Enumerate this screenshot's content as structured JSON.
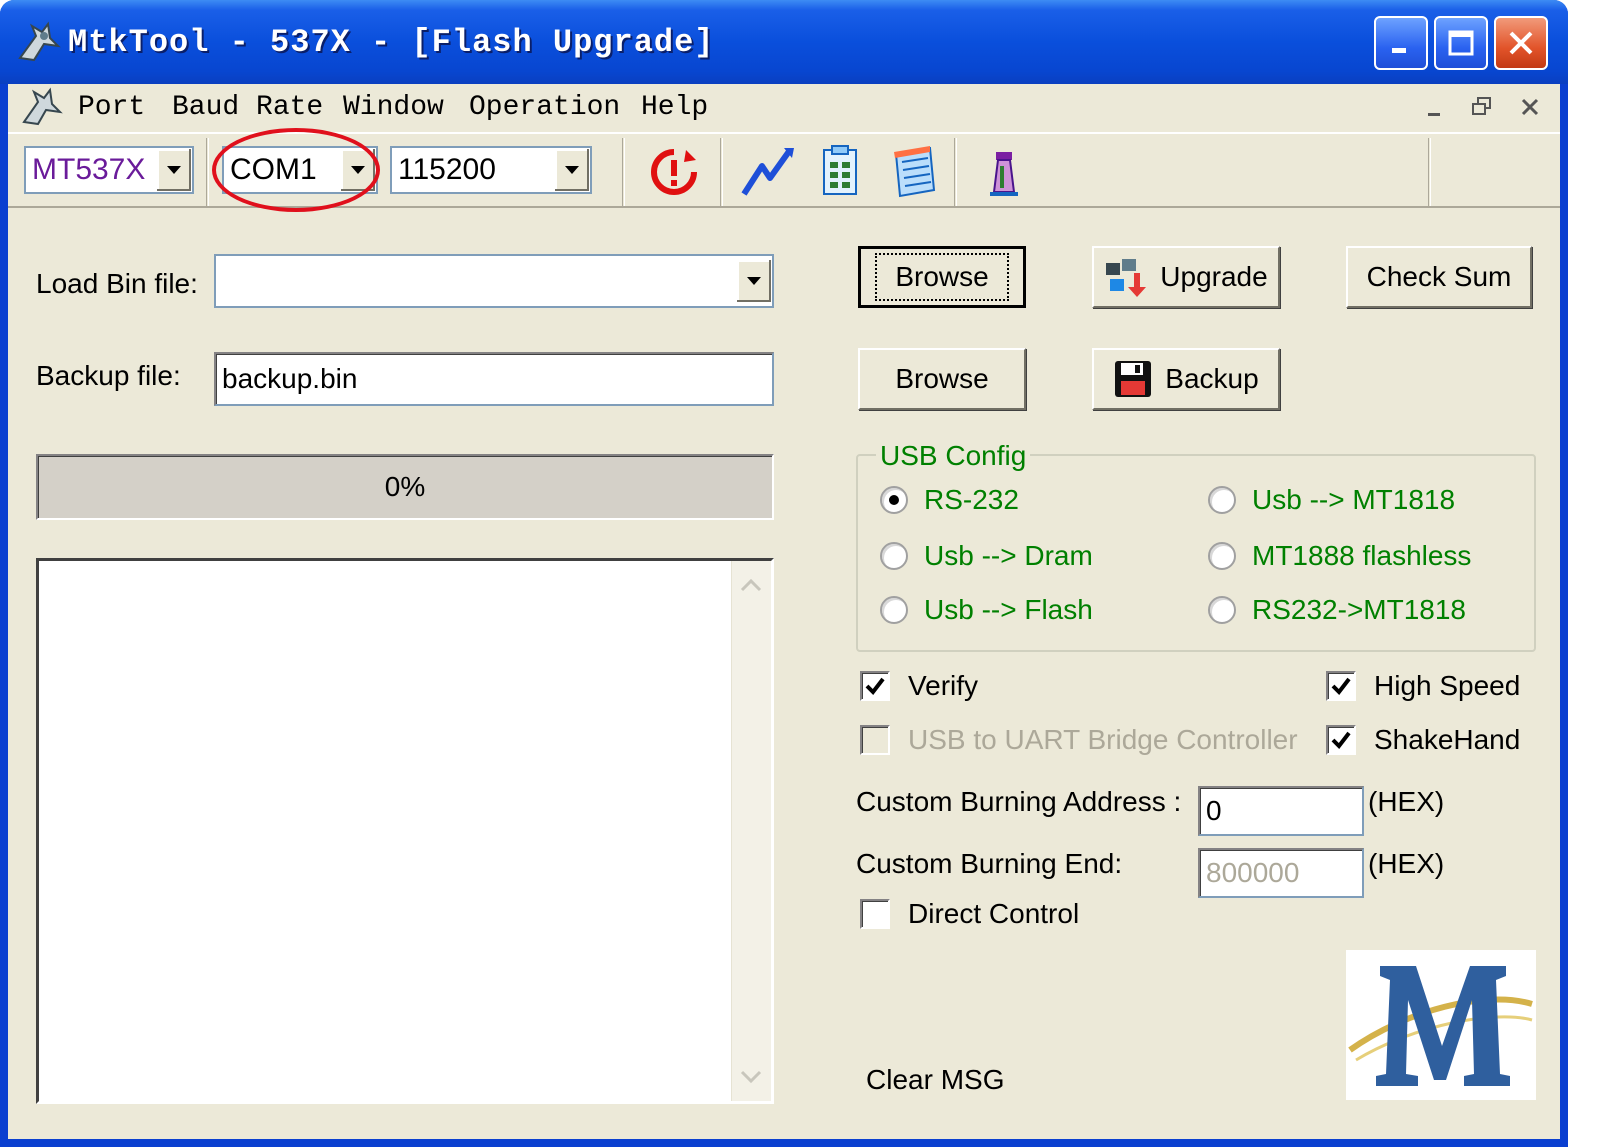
{
  "window": {
    "title": "MtkTool - 537X - [Flash Upgrade]",
    "controls": [
      "minimize",
      "maximize",
      "close"
    ]
  },
  "menubar": {
    "items": [
      {
        "label": "Port"
      },
      {
        "label": "Baud Rate"
      },
      {
        "label": "Window"
      },
      {
        "label": "Operation"
      },
      {
        "label": "Help"
      }
    ]
  },
  "toolbar": {
    "chip_select": {
      "value": "MT537X"
    },
    "port_select": {
      "value": "COM1"
    },
    "baud_select": {
      "value": "115200"
    },
    "icons": [
      "stop-icon",
      "signal-icon",
      "chip-icon",
      "notepad-icon",
      "tower-icon"
    ]
  },
  "form": {
    "load_bin_label": "Load Bin file:",
    "load_bin_value": "",
    "backup_label": "Backup file:",
    "backup_value": "backup.bin",
    "browse1_label": "Browse",
    "browse2_label": "Browse",
    "upgrade_label": "Upgrade",
    "checksum_label": "Check Sum",
    "backup_button_label": "Backup",
    "progress_text": "0%",
    "progress_value": 0
  },
  "usb_config": {
    "title": "USB Config",
    "options": [
      {
        "label": "RS-232",
        "selected": true
      },
      {
        "label": "Usb --> MT1818",
        "selected": false
      },
      {
        "label": "Usb --> Dram",
        "selected": false
      },
      {
        "label": "MT1888 flashless",
        "selected": false
      },
      {
        "label": "Usb --> Flash",
        "selected": false
      },
      {
        "label": "RS232->MT1818",
        "selected": false
      }
    ]
  },
  "options": {
    "verify": {
      "label": "Verify",
      "checked": true
    },
    "high_speed": {
      "label": "High Speed",
      "checked": true
    },
    "usb_uart": {
      "label": "USB to UART Bridge Controller",
      "checked": false,
      "disabled": true
    },
    "shakehand": {
      "label": "ShakeHand",
      "checked": true
    },
    "direct_control": {
      "label": "Direct Control",
      "checked": false
    }
  },
  "custom": {
    "address_label": "Custom Burning  Address :",
    "address_value": "0",
    "end_label": "Custom Burning  End:",
    "end_value": "800000",
    "hex1": "(HEX)",
    "hex2": "(HEX)"
  },
  "clear_msg_label": "Clear MSG",
  "colors": {
    "titlebar": "#0a4fdc",
    "face": "#ece9d8",
    "group_text": "#008000",
    "highlight": "#e0101c"
  }
}
